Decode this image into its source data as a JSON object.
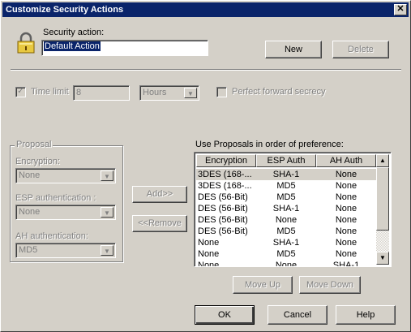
{
  "window": {
    "title": "Customize Security Actions",
    "close_label": "✕"
  },
  "security_action": {
    "label": "Security action:",
    "value": "Default Action"
  },
  "buttons": {
    "new": "New",
    "delete": "Delete",
    "add": "Add>>",
    "remove": "<<Remove",
    "move_up": "Move Up",
    "move_down": "Move Down",
    "ok": "OK",
    "cancel": "Cancel",
    "help": "Help"
  },
  "time_limit": {
    "label": "Time limit",
    "checked": true,
    "value": "8",
    "unit": "Hours"
  },
  "pfs": {
    "label": "Perfect forward secrecy",
    "checked": false
  },
  "proposal": {
    "group_label": "Proposal",
    "encryption_label": "Encryption:",
    "encryption_value": "None",
    "esp_label": "ESP authentication :",
    "esp_value": "None",
    "ah_label": "AH authentication:",
    "ah_value": "MD5"
  },
  "proposals_list": {
    "label": "Use Proposals in order of preference:",
    "columns": [
      "Encryption",
      "ESP Auth",
      "AH Auth"
    ],
    "rows": [
      [
        "3DES (168-...",
        "SHA-1",
        "None"
      ],
      [
        "3DES (168-...",
        "MD5",
        "None"
      ],
      [
        "DES (56-Bit)",
        "MD5",
        "None"
      ],
      [
        "DES (56-Bit)",
        "SHA-1",
        "None"
      ],
      [
        "DES (56-Bit)",
        "None",
        "None"
      ],
      [
        "DES (56-Bit)",
        "MD5",
        "None"
      ],
      [
        "None",
        "SHA-1",
        "None"
      ],
      [
        "None",
        "MD5",
        "None"
      ],
      [
        "None",
        "None",
        "SHA-1"
      ]
    ]
  },
  "icons": {
    "lock": "lock-icon"
  }
}
